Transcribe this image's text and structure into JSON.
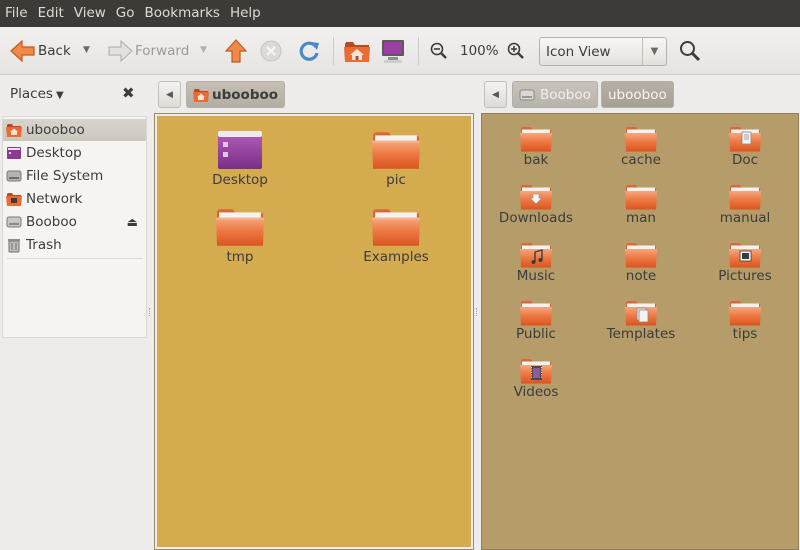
{
  "menu": [
    "File",
    "Edit",
    "View",
    "Go",
    "Bookmarks",
    "Help"
  ],
  "toolbar": {
    "back_label": "Back",
    "forward_label": "Forward",
    "zoom_level": "100%",
    "view_mode": "Icon View"
  },
  "sidebar": {
    "header": "Places",
    "items": [
      {
        "label": "ubooboo",
        "icon": "home-folder-icon",
        "selected": true
      },
      {
        "label": "Desktop",
        "icon": "desktop-icon"
      },
      {
        "label": "File System",
        "icon": "drive-icon"
      },
      {
        "label": "Network",
        "icon": "network-icon"
      },
      {
        "label": "Booboo",
        "icon": "removable-drive-icon",
        "eject": true
      },
      {
        "label": "Trash",
        "icon": "trash-icon"
      }
    ]
  },
  "left_pane": {
    "breadcrumb": [
      "ubooboo"
    ],
    "items": [
      "Desktop",
      "pic",
      "tmp",
      "Examples"
    ]
  },
  "right_pane": {
    "breadcrumb": [
      "Booboo",
      "ubooboo"
    ],
    "items": [
      "bak",
      "cache",
      "Doc",
      "Downloads",
      "man",
      "manual",
      "Music",
      "note",
      "Pictures",
      "Public",
      "Templates",
      "tips",
      "Videos"
    ]
  },
  "colors": {
    "menubar": "#3c3b37",
    "left_pane_bg": "#d4ab4f",
    "right_pane_bg": "#b59c69",
    "folder_orange": "#e8652b"
  }
}
